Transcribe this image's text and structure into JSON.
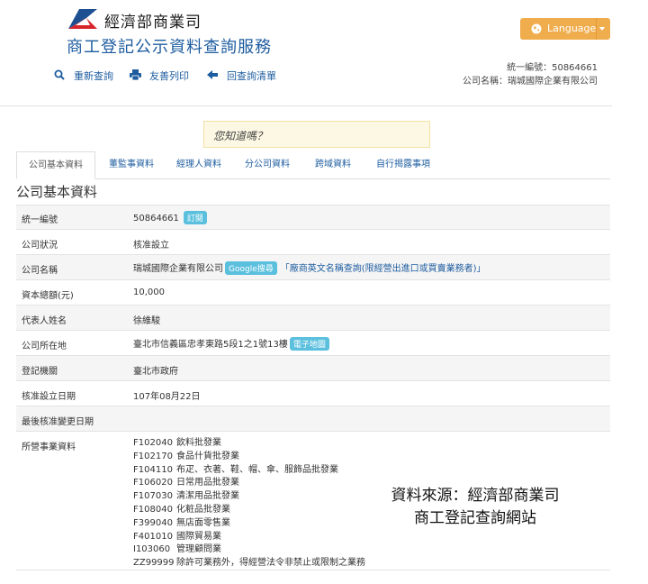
{
  "header": {
    "org_name": "經濟部商業司",
    "site_title": "商工登記公示資料查詢服務",
    "language_label": "Language",
    "toolbar": [
      {
        "label": "重新查詢",
        "icon": "search-icon"
      },
      {
        "label": "友善列印",
        "icon": "print-icon"
      },
      {
        "label": "回查詢清單",
        "icon": "arrow-left-icon"
      }
    ],
    "meta_id": "統一編號：50864661",
    "meta_name": "公司名稱：瑞城國際企業有限公司"
  },
  "notice": "您知道嗎？",
  "tabs": [
    "公司基本資料",
    "董監事資料",
    "經理人資料",
    "分公司資料",
    "跨域資料",
    "自行揭露事項"
  ],
  "section_title": "公司基本資料",
  "rows": {
    "uid": {
      "label": "統一編號",
      "value": "50864661",
      "badge": "訂閱"
    },
    "status": {
      "label": "公司狀況",
      "value": "核准設立"
    },
    "name": {
      "label": "公司名稱",
      "value": "瑞城國際企業有限公司",
      "badge": "Google搜尋",
      "eng": "「廠商英文名稱查詢(限經營出進口或買賣業務者)」"
    },
    "capital": {
      "label": "資本總額(元)",
      "value": "10,000"
    },
    "rep": {
      "label": "代表人姓名",
      "value": "徐維駿"
    },
    "address": {
      "label": "公司所在地",
      "value": "臺北市信義區忠孝東路5段1之1號13樓",
      "badge": "電子地圖"
    },
    "authority": {
      "label": "登記機關",
      "value": "臺北市政府"
    },
    "approve_date": {
      "label": "核准設立日期",
      "value": "107年08月22日"
    },
    "last_change": {
      "label": "最後核准變更日期",
      "value": ""
    },
    "business": {
      "label": "所營事業資料"
    }
  },
  "business_items": [
    {
      "code": "F102040",
      "desc": "飲料批發業"
    },
    {
      "code": "F102170",
      "desc": "食品什貨批發業"
    },
    {
      "code": "F104110",
      "desc": "布疋、衣著、鞋、帽、傘、服飾品批發業"
    },
    {
      "code": "F106020",
      "desc": "日常用品批發業"
    },
    {
      "code": "F107030",
      "desc": "清潔用品批發業"
    },
    {
      "code": "F108040",
      "desc": "化粧品批發業"
    },
    {
      "code": "F399040",
      "desc": "無店面零售業"
    },
    {
      "code": "F401010",
      "desc": "國際貿易業"
    },
    {
      "code": "I103060",
      "desc": "管理顧問業"
    },
    {
      "code": "ZZ99999",
      "desc": "除許可業務外，得經營法令非禁止或限制之業務"
    }
  ],
  "source_note": [
    "資料來源：經濟部商業司",
    "商工登記查詢網站"
  ],
  "colors": {
    "accent": "#1d5c9f",
    "language_button": "#f0ad4e",
    "badge": "#5bc0de",
    "notice_bg": "#fcf8e3"
  }
}
